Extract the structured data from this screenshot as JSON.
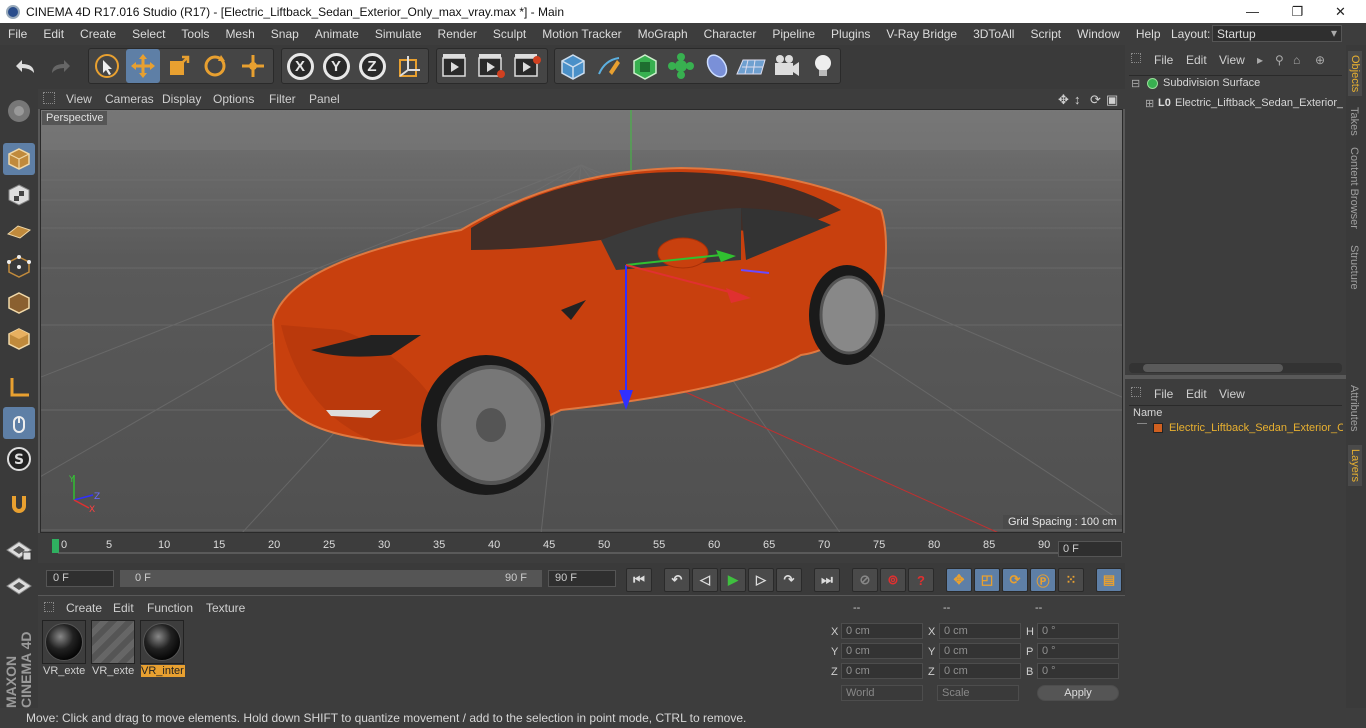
{
  "window": {
    "title": "CINEMA 4D R17.016 Studio (R17) - [Electric_Liftback_Sedan_Exterior_Only_max_vray.max *] - Main",
    "minimize": "—",
    "maximize": "❐",
    "close": "✕"
  },
  "menubar": {
    "items": [
      "File",
      "Edit",
      "Create",
      "Select",
      "Tools",
      "Mesh",
      "Snap",
      "Animate",
      "Simulate",
      "Render",
      "Sculpt",
      "Motion Tracker",
      "MoGraph",
      "Character",
      "Pipeline",
      "Plugins",
      "V-Ray Bridge",
      "3DToAll",
      "Script",
      "Window",
      "Help"
    ],
    "layout_label": "Layout:",
    "layout_value": "Startup"
  },
  "toolbar": {
    "axis_x": "X",
    "axis_y": "Y",
    "axis_z": "Z"
  },
  "viewport": {
    "menu": [
      "View",
      "Cameras",
      "Display",
      "Options",
      "Filter",
      "Panel"
    ],
    "camera_label": "Perspective",
    "grid_spacing": "Grid Spacing : 100 cm",
    "axis_labels": {
      "y": "Y",
      "z": "Z",
      "x": "X"
    }
  },
  "timeline": {
    "ticks": [
      "0",
      "5",
      "10",
      "15",
      "20",
      "25",
      "30",
      "35",
      "40",
      "45",
      "50",
      "55",
      "60",
      "65",
      "70",
      "75",
      "80",
      "85",
      "90"
    ],
    "current_frame": "0 F"
  },
  "playback": {
    "start_field": "0 F",
    "range_start": "0 F",
    "range_end": "90 F",
    "end_field": "90 F"
  },
  "material_manager": {
    "menu": [
      "Create",
      "Edit",
      "Function",
      "Texture"
    ],
    "materials": [
      "VR_exte",
      "VR_exte",
      "VR_inter"
    ],
    "selected_index": 2
  },
  "coordinates": {
    "headers": [
      "--",
      "--",
      "--"
    ],
    "rows": [
      {
        "l1": "X",
        "v1": "0 cm",
        "l2": "X",
        "v2": "0 cm",
        "l3": "H",
        "v3": "0 °"
      },
      {
        "l1": "Y",
        "v1": "0 cm",
        "l2": "Y",
        "v2": "0 cm",
        "l3": "P",
        "v3": "0 °"
      },
      {
        "l1": "Z",
        "v1": "0 cm",
        "l2": "Z",
        "v2": "0 cm",
        "l3": "B",
        "v3": "0 °"
      }
    ],
    "world": "World",
    "scale": "Scale",
    "apply": "Apply"
  },
  "object_manager": {
    "menu": [
      "File",
      "Edit",
      "View"
    ],
    "objects": [
      "Subdivision Surface",
      "Electric_Liftback_Sedan_Exterior_"
    ]
  },
  "attribute_manager": {
    "menu": [
      "File",
      "Edit",
      "View"
    ],
    "name_header": "Name",
    "layer_item": "Electric_Liftback_Sedan_Exterior_C"
  },
  "right_tabs": [
    "Objects",
    "Takes",
    "Content Browser",
    "Structure",
    "Attributes",
    "Layers"
  ],
  "maxon_logo": "MAXON CINEMA 4D",
  "status": "Move: Click and drag to move elements. Hold down SHIFT to quantize movement / add to the selection in point mode, CTRL to remove.",
  "colors": {
    "accent": "#5e7fa6",
    "car": "#c8400e",
    "selection": "#e8b030"
  }
}
